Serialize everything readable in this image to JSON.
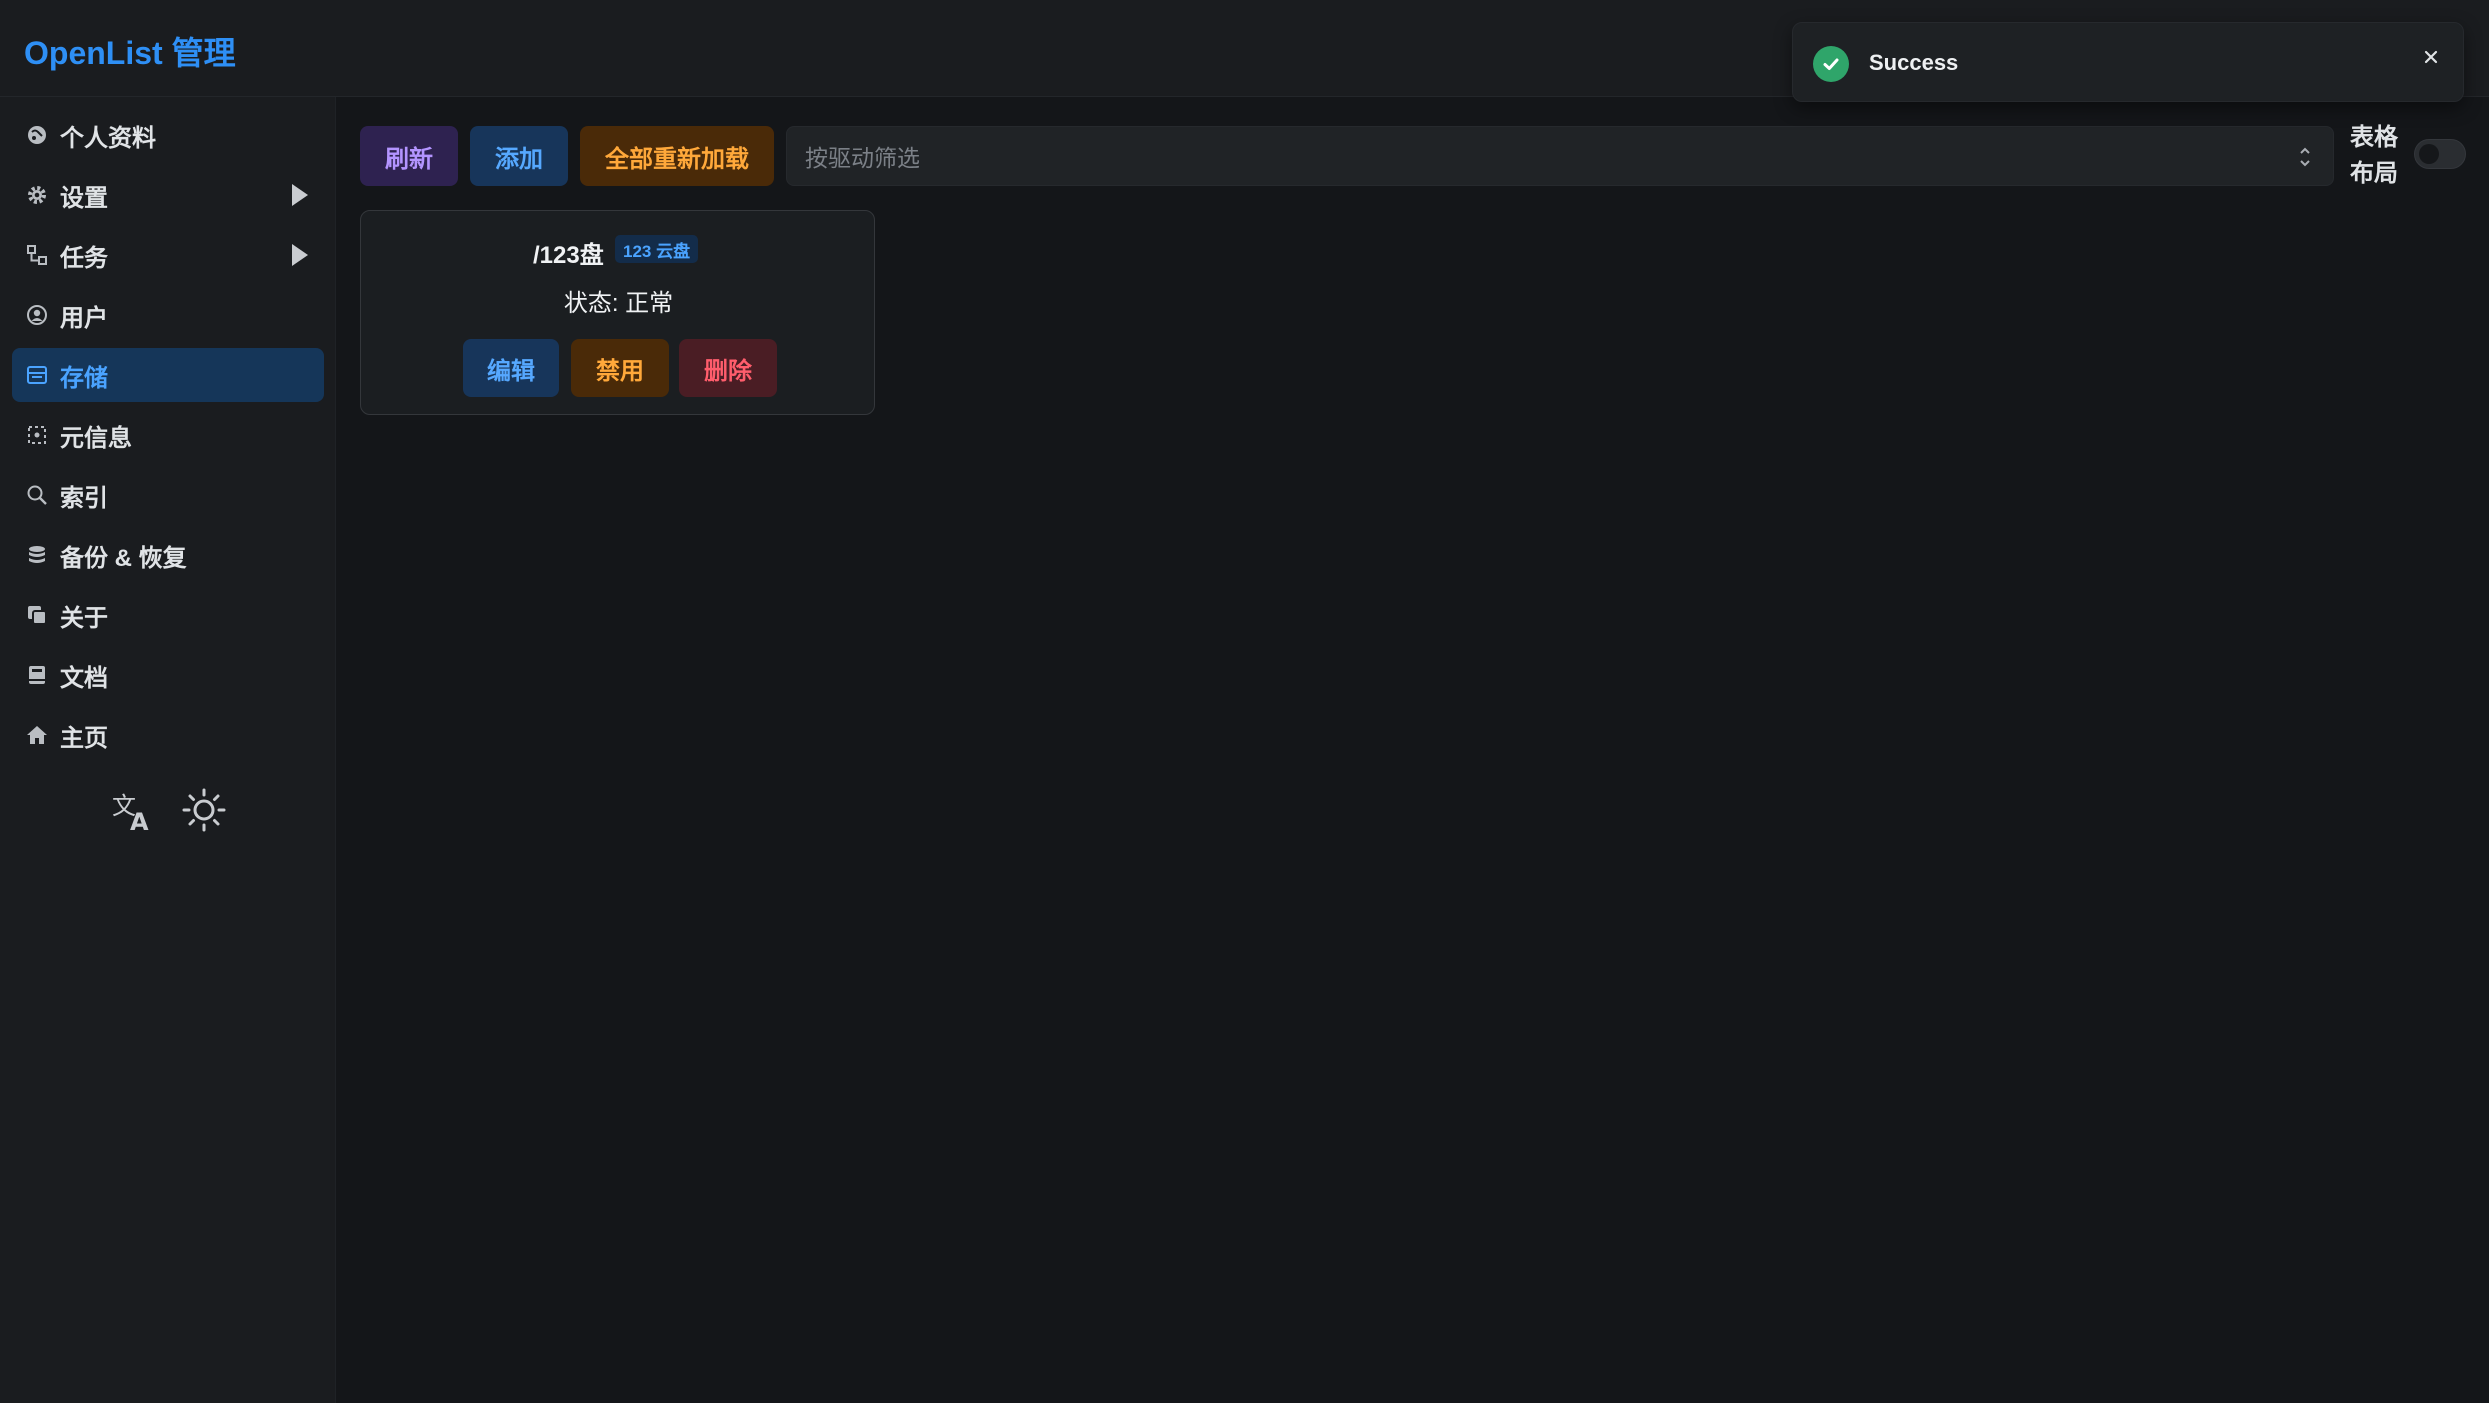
{
  "header": {
    "title": "OpenList 管理"
  },
  "sidebar": {
    "items": [
      {
        "label": "个人资料",
        "icon": "profile-icon"
      },
      {
        "label": "设置",
        "icon": "gear-icon"
      },
      {
        "label": "任务",
        "icon": "tasks-icon"
      },
      {
        "label": "用户",
        "icon": "user-icon"
      },
      {
        "label": "存储",
        "icon": "storage-icon"
      },
      {
        "label": "元信息",
        "icon": "metadata-icon"
      },
      {
        "label": "索引",
        "icon": "search-icon"
      },
      {
        "label": "备份 & 恢复",
        "icon": "database-icon"
      },
      {
        "label": "关于",
        "icon": "about-icon"
      },
      {
        "label": "文档",
        "icon": "book-icon"
      },
      {
        "label": "主页",
        "icon": "home-icon"
      }
    ],
    "active_item": "存储",
    "tools": [
      "translate-icon",
      "sun-icon"
    ]
  },
  "toolbar": {
    "refresh_label": "刷新",
    "add_label": "添加",
    "reload_all_label": "全部重新加载",
    "filter_placeholder": "按驱动筛选",
    "layout_label_line1": "表格",
    "layout_label_line2": "布局",
    "table_layout_enabled": false
  },
  "storages": [
    {
      "mount_path": "/123盘",
      "driver_badge": "123 云盘",
      "status_label": "状态:",
      "status_value": "正常",
      "edit_label": "编辑",
      "disable_label": "禁用",
      "delete_label": "删除"
    }
  ],
  "toast": {
    "message": "Success",
    "close_icon": "close-icon"
  },
  "colors": {
    "accent": "#2e8ff5",
    "background": "#141619",
    "sidebar": "#1a1c1f",
    "active_nav": "#153659",
    "success": "#2fa56a",
    "warning": "#ffa83a",
    "danger": "#ff5d6c",
    "purple": "#b394ff"
  }
}
